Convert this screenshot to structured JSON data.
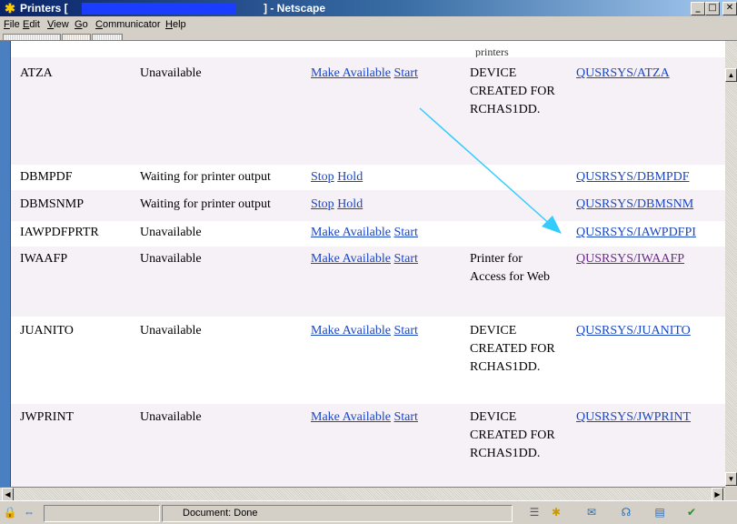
{
  "window": {
    "title_prefix": "Printers [",
    "title_suffix": "] - Netscape",
    "minimize": "_",
    "maximize": "□",
    "close": "✕",
    "app_icon": "netscape-icon"
  },
  "menu": [
    "File",
    "Edit",
    "View",
    "Go",
    "Communicator",
    "Help"
  ],
  "content": {
    "clipped_top_text": "printers",
    "rows": [
      {
        "name": "ATZA",
        "status": "Unavailable",
        "action1": "Make Available",
        "action2": "Start",
        "description": "DEVICE CREATED FOR RCHAS1DD.",
        "output_queue": "QUSRSYS/ATZA"
      },
      {
        "name": "DBMPDF",
        "status": "Waiting for printer output",
        "action1": "Stop",
        "action2": "Hold",
        "description": "",
        "output_queue": "QUSRSYS/DBMPDF"
      },
      {
        "name": "DBMSNMP",
        "status": "Waiting for printer output",
        "action1": "Stop",
        "action2": "Hold",
        "description": "",
        "output_queue": "QUSRSYS/DBMSNM"
      },
      {
        "name": "IAWPDFPRTR",
        "status": "Unavailable",
        "action1": "Make Available",
        "action2": "Start",
        "description": "",
        "output_queue": "QUSRSYS/IAWPDFPI"
      },
      {
        "name": "IWAAFP",
        "status": "Unavailable",
        "action1": "Make Available",
        "action2": "Start",
        "description": "Printer for Access for Web",
        "output_queue": "QUSRSYS/IWAAFP"
      },
      {
        "name": "JUANITO",
        "status": "Unavailable",
        "action1": "Make Available",
        "action2": "Start",
        "description": "DEVICE CREATED FOR RCHAS1DD.",
        "output_queue": "QUSRSYS/JUANITO"
      },
      {
        "name": "JWPRINT",
        "status": "Unavailable",
        "action1": "Make Available",
        "action2": "Start",
        "description": "DEVICE CREATED FOR RCHAS1DD.",
        "output_queue": "QUSRSYS/JWPRINT"
      }
    ]
  },
  "status": {
    "text": "Document: Done"
  },
  "colors": {
    "annotation_arrow": "#33ccff",
    "link": "#1a46c4",
    "visited_link": "#6b2a8c",
    "row_shade": "#f6f0f7"
  }
}
